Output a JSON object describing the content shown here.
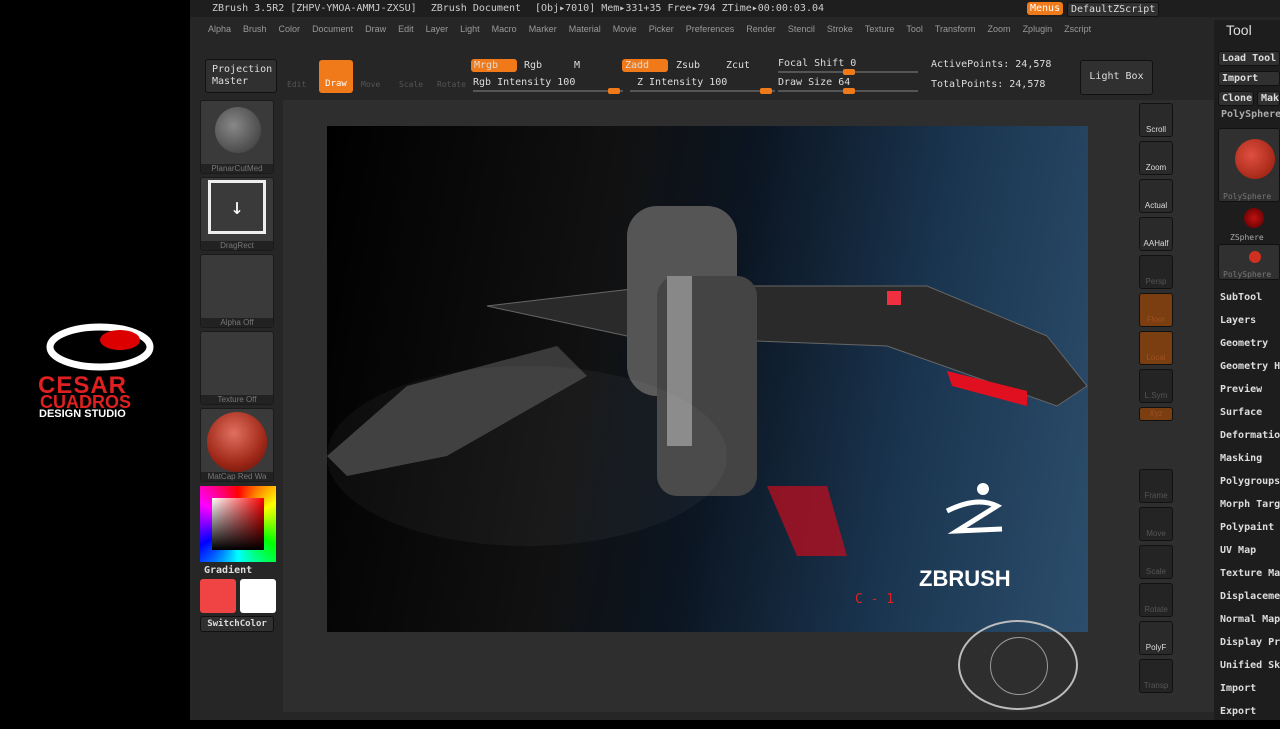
{
  "brand": {
    "line1": "CESAR",
    "line2": "CUADROS",
    "line3": "DESIGN STUDIO"
  },
  "titlebar": {
    "app": "ZBrush 3.5R2 [ZHPV-YMOA-AMMJ-ZXSU]",
    "doc": "ZBrush Document",
    "stats": "[Obj▸7010] Mem▸331+35 Free▸794 ZTime▸00:00:03.04",
    "menus": "Menus",
    "script": "DefaultZScript"
  },
  "menubar": [
    "Alpha",
    "Brush",
    "Color",
    "Document",
    "Draw",
    "Edit",
    "Layer",
    "Light",
    "Macro",
    "Marker",
    "Material",
    "Movie",
    "Picker",
    "Preferences",
    "Render",
    "Stencil",
    "Stroke",
    "Texture",
    "Tool",
    "Transform",
    "Zoom",
    "Zplugin",
    "Zscript"
  ],
  "toolbar": {
    "projection_master": "Projection Master",
    "edit": "Edit",
    "draw": "Draw",
    "move": "Move",
    "scale": "Scale",
    "rotate": "Rotate",
    "mrgb": "Mrgb",
    "rgb": "Rgb",
    "m": "M",
    "zadd": "Zadd",
    "zsub": "Zsub",
    "zcut": "Zcut",
    "rgb_intensity": "Rgb Intensity 100",
    "z_intensity": "Z Intensity 100",
    "focal_shift": "Focal Shift 0",
    "draw_size": "Draw Size 64",
    "active_points": "ActivePoints: 24,578",
    "total_points": "TotalPoints: 24,578",
    "light_box": "Light Box",
    "values": {
      "rgb_intensity": 100,
      "z_intensity": 100,
      "focal_shift": 0,
      "draw_size": 64
    }
  },
  "left_shelf": {
    "brush": "PlanarCutMed",
    "stroke": "DragRect",
    "alpha": "Alpha Off",
    "texture": "Texture Off",
    "material": "MatCap Red Wa",
    "gradient": "Gradient",
    "switch_color": "SwitchColor",
    "main_color": "#f04444",
    "secondary_color": "#ffffff"
  },
  "right_shelf": [
    "Scroll",
    "Zoom",
    "Actual",
    "AAHalf",
    "Persp",
    "Floor",
    "Local",
    "L.Sym",
    "Xyz",
    "",
    "",
    "Frame",
    "Move",
    "Scale",
    "Rotate",
    "PolyF",
    "Transp",
    ""
  ],
  "canvas": {
    "logo": "ZBRUSH",
    "marker": "C - 1"
  },
  "tool_panel": {
    "title": "Tool",
    "load": "Load Tool",
    "import_btn": "Import",
    "clone": "Clone",
    "make": "Make",
    "current": "PolySphere",
    "thumbs": [
      "PolySphere",
      "ZSphere",
      "PolySphere"
    ],
    "items": [
      "SubTool",
      "Layers",
      "Geometry",
      "Geometry HD",
      "Preview",
      "Surface",
      "Deformation",
      "Masking",
      "Polygroups",
      "Morph Target",
      "Polypaint",
      "UV Map",
      "Texture Map",
      "Displacement",
      "Normal Map",
      "Display Properties",
      "Unified Skin",
      "Import",
      "Export"
    ]
  }
}
